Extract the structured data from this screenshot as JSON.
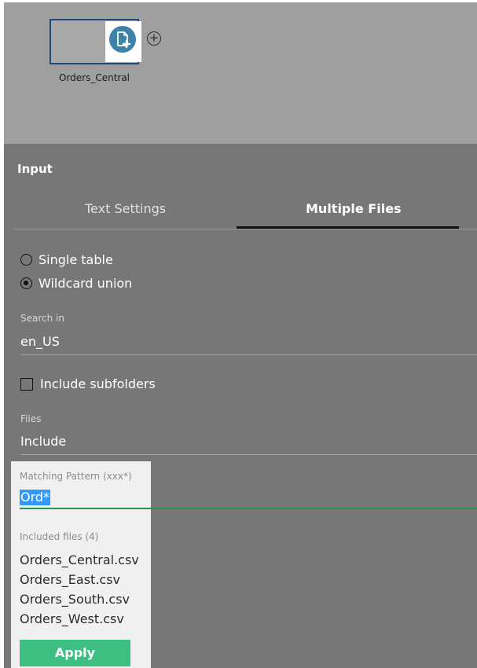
{
  "flow": {
    "node": {
      "label": "Orders_Central",
      "icon": "file-add-icon",
      "add_icon": "plus-circle-icon",
      "accent": "#3d82a8"
    }
  },
  "pane": {
    "title": "Input",
    "tabs": [
      {
        "label": "Text Settings",
        "active": false
      },
      {
        "label": "Multiple Files",
        "active": true
      }
    ],
    "union_mode": {
      "options": [
        {
          "label": "Single table",
          "checked": false
        },
        {
          "label": "Wildcard union",
          "checked": true
        }
      ]
    },
    "search_in": {
      "label": "Search in",
      "value": "en_US"
    },
    "include_subfolders": {
      "label": "Include subfolders",
      "checked": false
    },
    "files": {
      "label": "Files",
      "value": "Include"
    },
    "matching_pattern": {
      "label": "Matching Pattern (xxx*)",
      "value": "Ord*"
    },
    "included_files": {
      "label": "Included files (4)",
      "items": [
        "Orders_Central.csv",
        "Orders_East.csv",
        "Orders_South.csv",
        "Orders_West.csv"
      ]
    },
    "apply_label": "Apply",
    "apply_color": "#3dbf82"
  }
}
